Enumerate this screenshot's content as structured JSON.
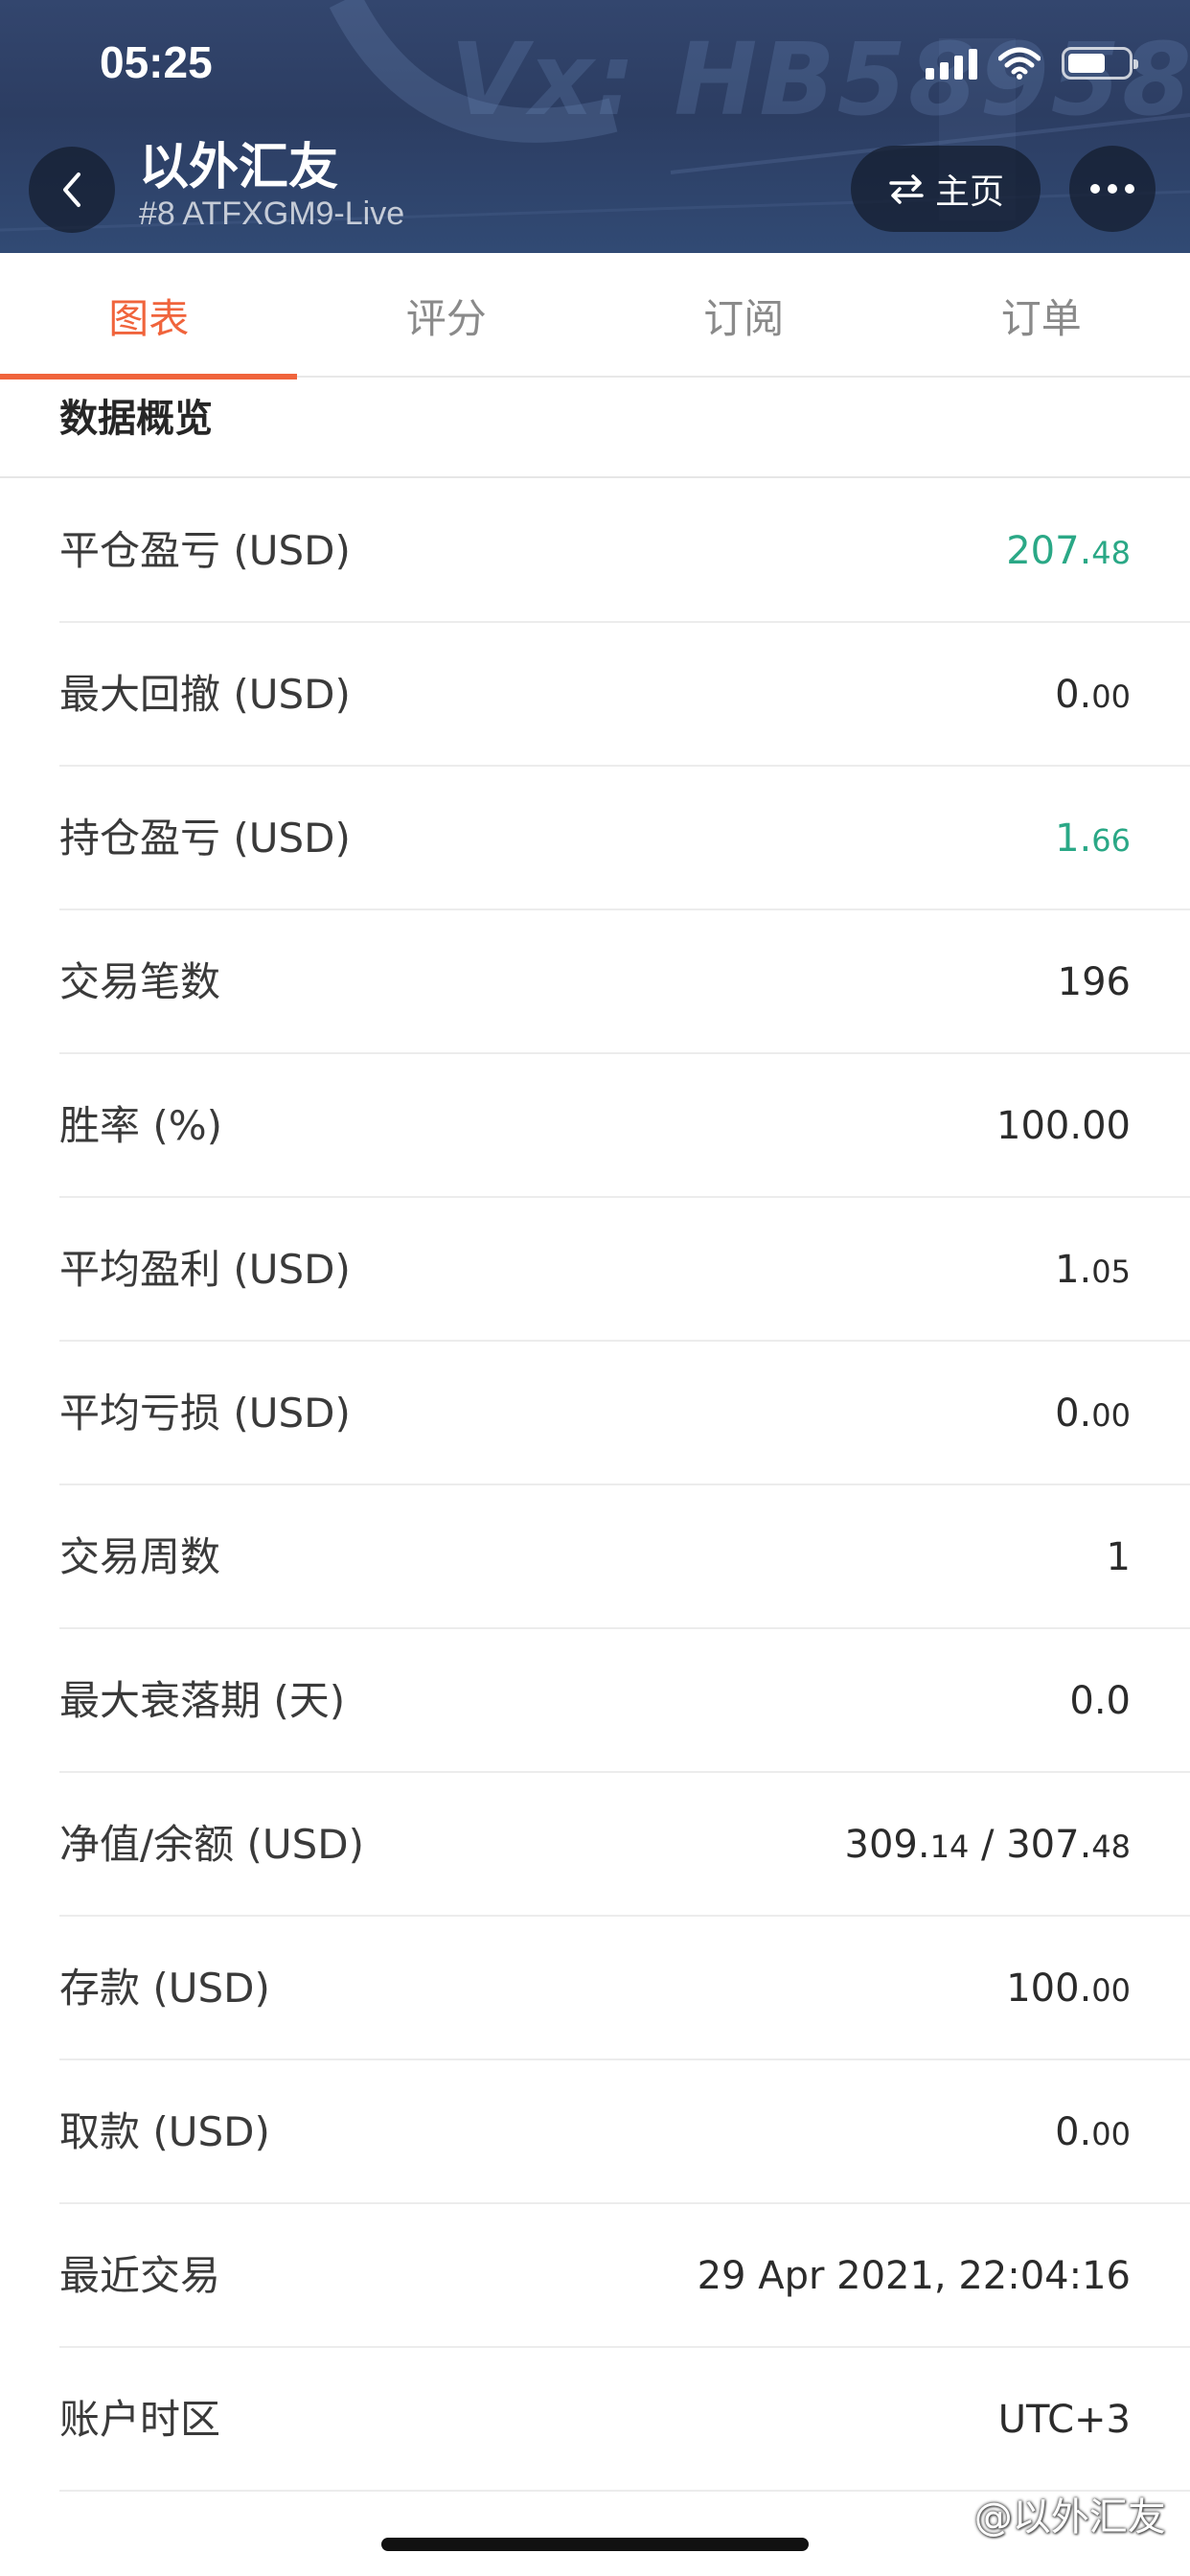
{
  "status_bar": {
    "time": "05:25"
  },
  "header": {
    "watermark": "Vx: HB58958",
    "title": "以外汇友",
    "subtitle": "#8 ATFXGM9-Live",
    "home_label": "主页",
    "icons": {
      "back": "chevron-left-icon",
      "swap": "swap-arrows-icon",
      "more": "more-dots-icon"
    }
  },
  "tabs": [
    {
      "label": "图表",
      "active": true
    },
    {
      "label": "评分",
      "active": false
    },
    {
      "label": "订阅",
      "active": false
    },
    {
      "label": "订单",
      "active": false
    }
  ],
  "section": {
    "title": "数据概览"
  },
  "stats": [
    {
      "label": "平仓盈亏 (USD)",
      "main": "207.",
      "small": "48",
      "color": "#2aa886"
    },
    {
      "label": "最大回撤 (USD)",
      "main": "0.",
      "small": "00"
    },
    {
      "label": "持仓盈亏 (USD)",
      "main": "1.",
      "small": "66",
      "color": "#2aa886"
    },
    {
      "label": "交易笔数",
      "main": "196",
      "small": ""
    },
    {
      "label": "胜率 (%)",
      "main": "100.00",
      "small": ""
    },
    {
      "label": "平均盈利 (USD)",
      "main": "1.",
      "small": "05"
    },
    {
      "label": "平均亏损 (USD)",
      "main": "0.",
      "small": "00"
    },
    {
      "label": "交易周数",
      "main": "1",
      "small": ""
    },
    {
      "label": "最大衰落期 (天)",
      "main": "0.0",
      "small": ""
    },
    {
      "label": "净值/余额 (USD)",
      "main": "309.",
      "small": "14",
      "main2": " / 307.",
      "small2": "48"
    },
    {
      "label": "存款 (USD)",
      "main": "100.",
      "small": "00"
    },
    {
      "label": "取款 (USD)",
      "main": "0.",
      "small": "00"
    },
    {
      "label": "最近交易",
      "main": "29 Apr 2021, 22:04:16",
      "small": ""
    },
    {
      "label": "账户时区",
      "main": "UTC+3",
      "small": ""
    }
  ],
  "footer": {
    "credit": "@以外汇友"
  },
  "colors": {
    "accent": "#f0643c",
    "positive": "#2aa886",
    "header_bg": "#2f4268"
  }
}
